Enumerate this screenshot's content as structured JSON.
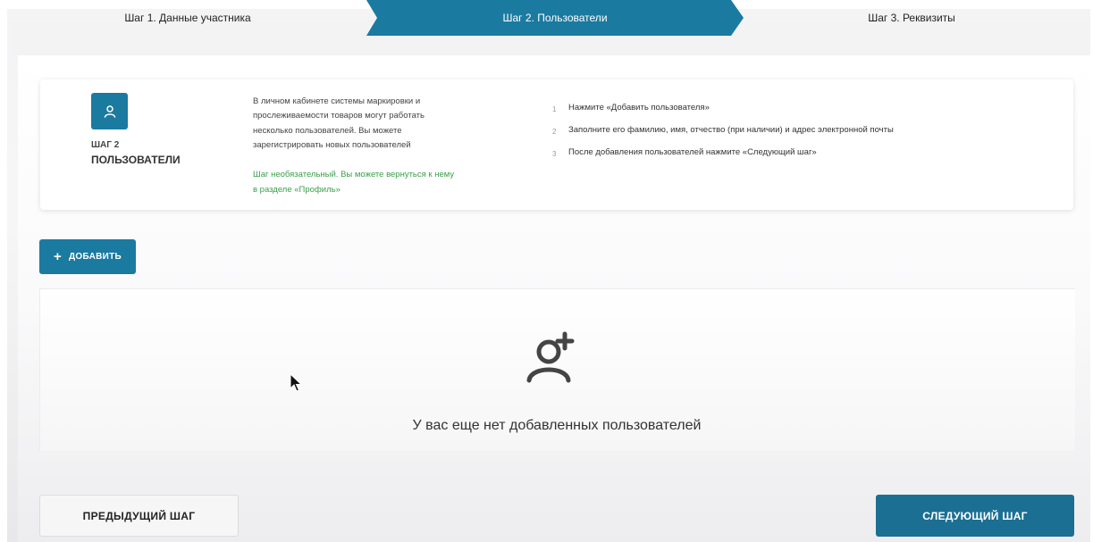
{
  "stepper": {
    "step1": "Шаг 1. Данные участника",
    "step2": "Шаг 2. Пользователи",
    "step3": "Шаг 3. Реквизиты"
  },
  "info": {
    "icon": "user-icon",
    "step_number": "ШАГ 2",
    "step_name": "ПОЛЬЗОВАТЕЛИ",
    "description_lines": [
      "В личном кабинете системы маркировки и",
      "прослеживаемости товаров могут работать",
      "несколько пользователей. Вы можете",
      "зарегистрировать новых пользователей"
    ],
    "hint_lines": [
      "Шаг необязательный. Вы можете вернуться к нему",
      "в разделе «Профиль»"
    ],
    "instructions": [
      {
        "num": "1",
        "text": "Нажмите «Добавить пользователя»"
      },
      {
        "num": "2",
        "text": "Заполните его фамилию, имя, отчество (при наличии) и адрес электронной почты"
      },
      {
        "num": "3",
        "text": "После добавления пользователей нажмите «Следующий шаг»"
      }
    ]
  },
  "add_button": {
    "icon": "plus-icon",
    "label": "ДОБАВИТЬ"
  },
  "empty_state": {
    "icon": "add-user-icon",
    "text": "У вас еще нет добавленных пользователей"
  },
  "footer": {
    "prev_label": "ПРЕДЫДУЩИЙ ШАГ",
    "next_label": "СЛЕДУЮЩИЙ ШАГ"
  },
  "colors": {
    "accent": "#1b7aa0",
    "accent_dark": "#1b6f93",
    "hint_green": "#3aa04a"
  }
}
